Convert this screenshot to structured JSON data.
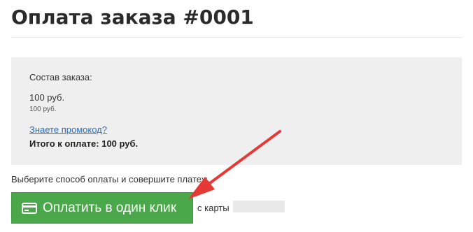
{
  "page": {
    "title": "Оплата заказа #0001"
  },
  "order_summary": {
    "heading": "Состав заказа:",
    "item_price": "100 руб.",
    "item_price_small": "100 руб.",
    "promo_link": "Знаете промокод?",
    "total": "Итого к оплате: 100 руб."
  },
  "payment": {
    "instruction": "Выберите способ оплаты и совершите платеж.",
    "pay_button_label": "Оплатить в один клик",
    "pay_button_icon": "credit-card-icon",
    "from_card_text": "с карты"
  },
  "colors": {
    "pay_button": "#4aa84a",
    "link": "#2a6fb6",
    "summary_background": "#efefef",
    "annotation_arrow": "#e53935"
  }
}
